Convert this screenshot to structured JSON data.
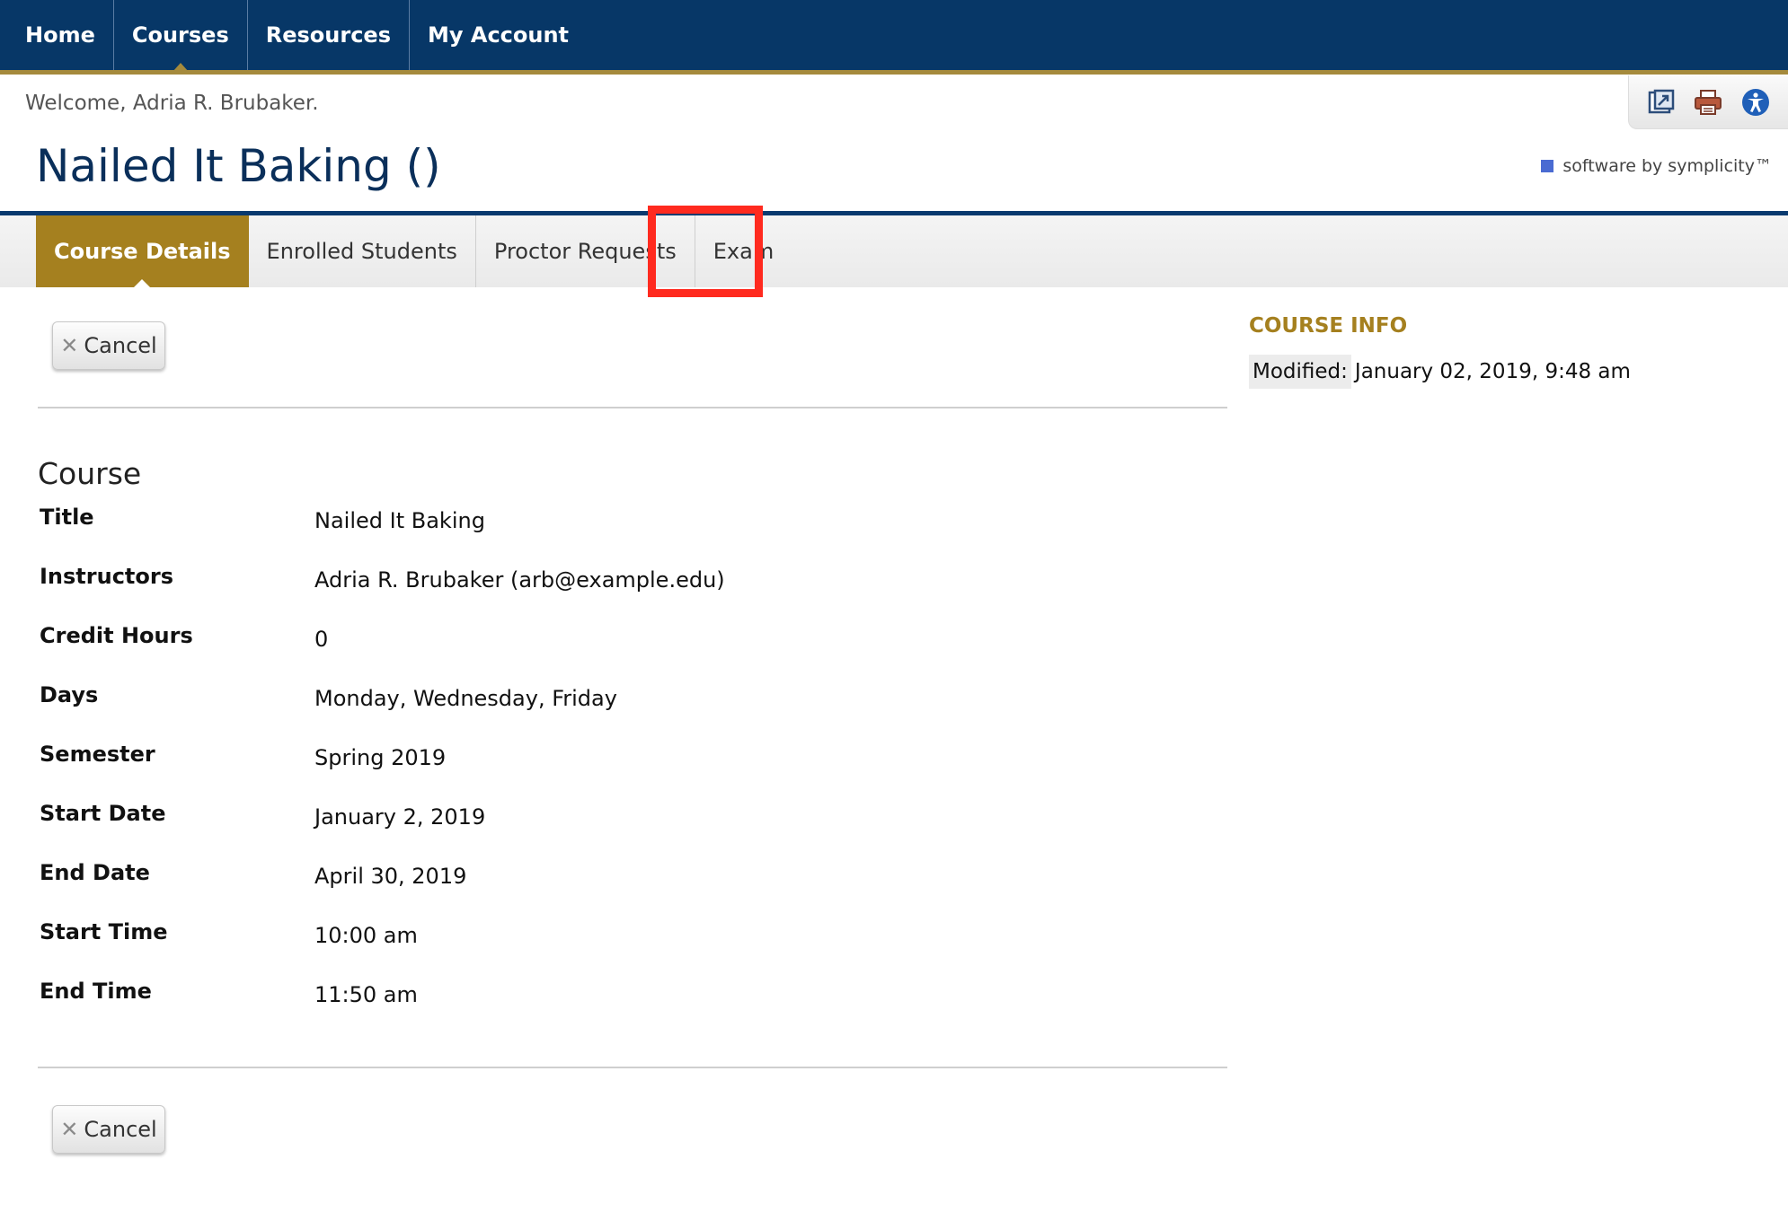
{
  "nav": {
    "items": [
      {
        "label": "Home"
      },
      {
        "label": "Courses"
      },
      {
        "label": "Resources"
      },
      {
        "label": "My Account"
      }
    ]
  },
  "header": {
    "welcome": "Welcome, Adria R. Brubaker.",
    "title": "Nailed It Baking ()",
    "vendor": "software by symplicity™",
    "tools": [
      "external-link-icon",
      "printer-icon",
      "accessibility-icon"
    ]
  },
  "tabs": [
    {
      "label": "Course Details",
      "active": true
    },
    {
      "label": "Enrolled Students"
    },
    {
      "label": "Proctor Requests"
    },
    {
      "label": "Exam"
    }
  ],
  "actions": {
    "cancel_label": "Cancel"
  },
  "course": {
    "section_title": "Course",
    "fields": [
      {
        "label": "Title",
        "value": "Nailed It Baking"
      },
      {
        "label": "Instructors",
        "value": "Adria R. Brubaker (arb@example.edu)"
      },
      {
        "label": "Credit Hours",
        "value": "0"
      },
      {
        "label": "Days",
        "value": "Monday, Wednesday, Friday"
      },
      {
        "label": "Semester",
        "value": "Spring 2019"
      },
      {
        "label": "Start Date",
        "value": "January 2, 2019"
      },
      {
        "label": "End Date",
        "value": "April 30, 2019"
      },
      {
        "label": "Start Time",
        "value": "10:00 am"
      },
      {
        "label": "End Time",
        "value": "11:50 am"
      }
    ]
  },
  "sidebar": {
    "title": "COURSE INFO",
    "modified_label": "Modified:",
    "modified_value": "January 02, 2019, 9:48 am"
  },
  "colors": {
    "nav_bg": "#073767",
    "accent_gold": "#a5801f",
    "title_blue": "#0a2f5a",
    "highlight_red": "#ff2a1f"
  }
}
